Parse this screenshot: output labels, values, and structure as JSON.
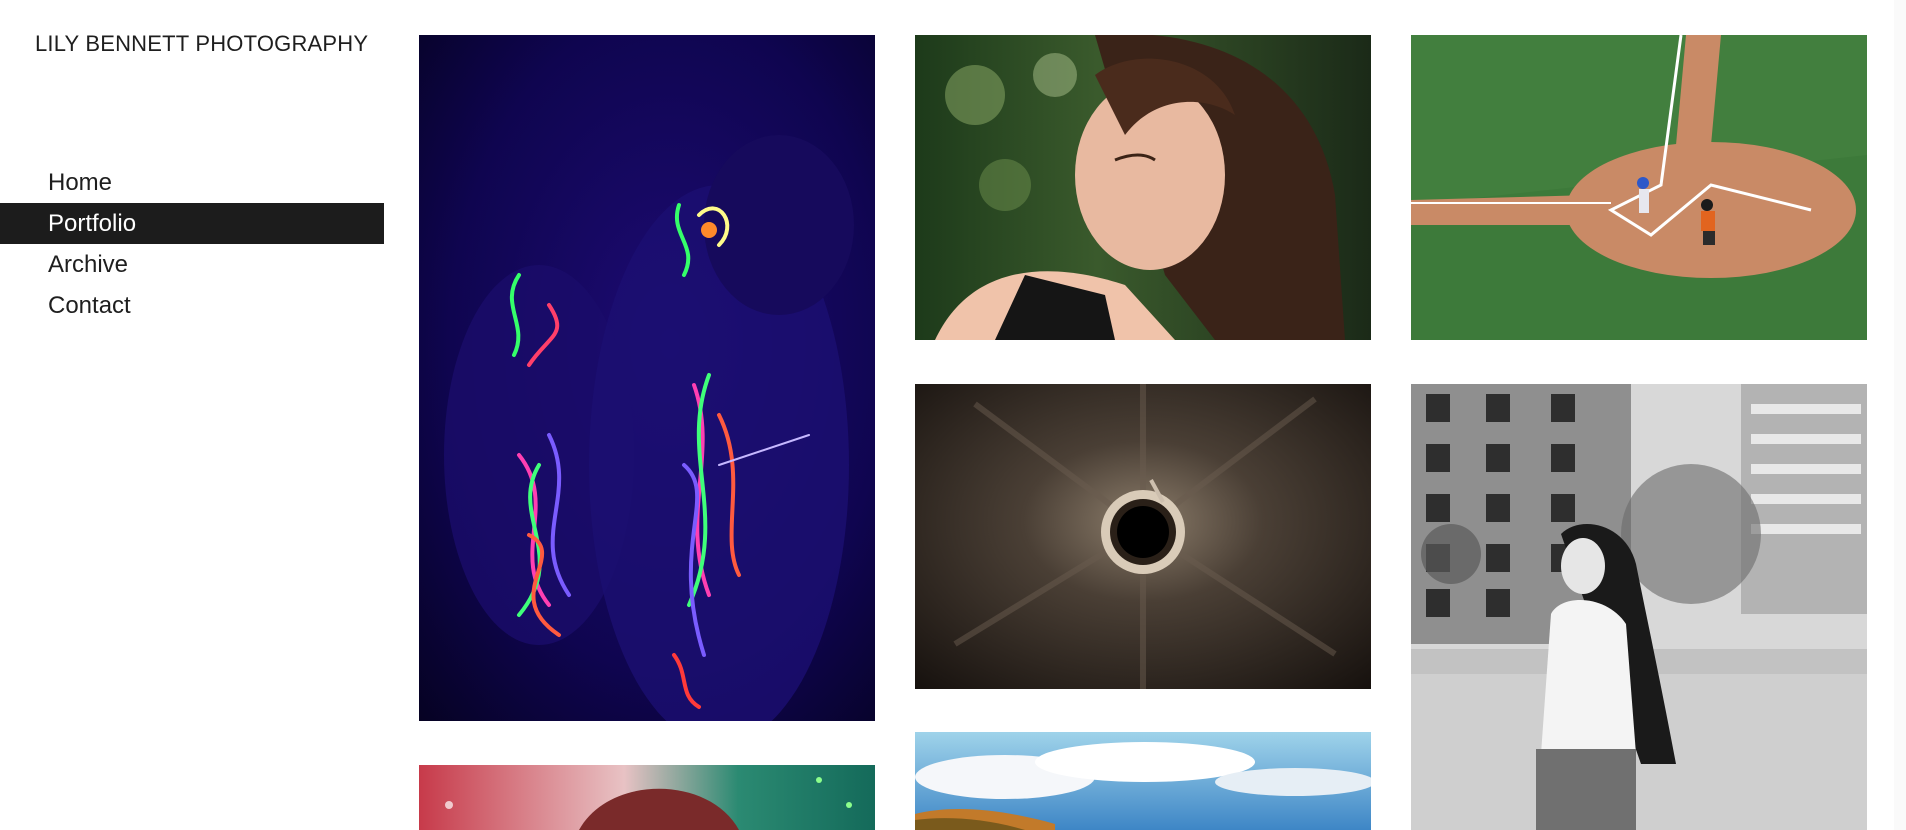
{
  "site": {
    "title": "LILY BENNETT PHOTOGRAPHY"
  },
  "nav": {
    "items": [
      {
        "label": "Home",
        "active": false
      },
      {
        "label": "Portfolio",
        "active": true
      },
      {
        "label": "Archive",
        "active": false
      },
      {
        "label": "Contact",
        "active": false
      }
    ]
  },
  "gallery": {
    "photos": [
      {
        "subject": "uv-body-paint-portrait"
      },
      {
        "subject": "woman-portrait-outdoors"
      },
      {
        "subject": "baseball-home-plate"
      },
      {
        "subject": "lamp-looking-up"
      },
      {
        "subject": "woman-bw-city"
      },
      {
        "subject": "party-portrait-partial"
      },
      {
        "subject": "autumn-landscape-sky-partial"
      }
    ]
  },
  "colors": {
    "nav_active_bg": "#1c1c1c",
    "nav_active_text": "#ffffff",
    "text": "#1e1e1e"
  }
}
